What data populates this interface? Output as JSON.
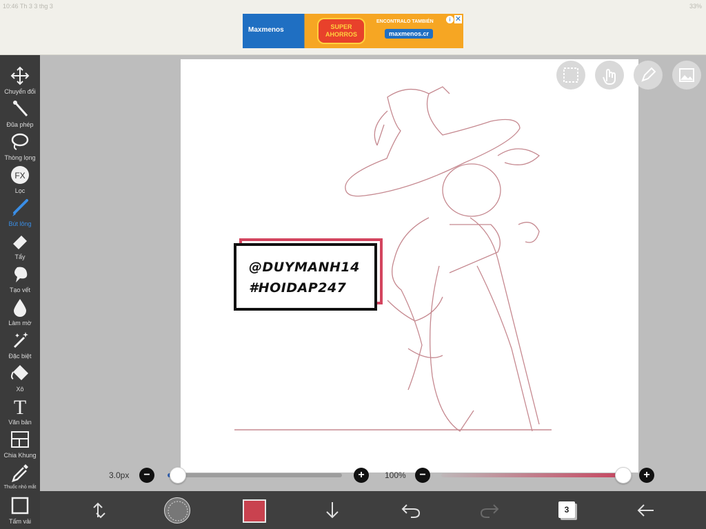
{
  "status_bar": {
    "left_text": "10:46  Th 3 3 thg 3",
    "right_text": "33%"
  },
  "ad": {
    "brand": "Maxmenos",
    "promo": "SUPER AHORROS",
    "tagline": "ENCONTRALO TAMBIÉN",
    "site": "maxmenos.cr",
    "info_icon": "info-icon",
    "close_icon": "close-icon"
  },
  "toolbar": {
    "items": [
      {
        "label": "Chuyển đổi",
        "icon": "move-arrows-icon"
      },
      {
        "label": "Đũa phép",
        "icon": "magic-wand-icon"
      },
      {
        "label": "Thòng lọng",
        "icon": "lasso-icon"
      },
      {
        "label": "Lọc",
        "icon": "fx-filter-icon"
      },
      {
        "label": "Bút lông",
        "icon": "brush-icon",
        "active": true
      },
      {
        "label": "Tẩy",
        "icon": "eraser-icon"
      },
      {
        "label": "Tạo vết",
        "icon": "smudge-icon"
      },
      {
        "label": "Làm mờ",
        "icon": "blur-drop-icon"
      },
      {
        "label": "Đặc biệt",
        "icon": "special-wand-icon"
      },
      {
        "label": "Xô",
        "icon": "bucket-icon"
      },
      {
        "label": "Văn bản",
        "icon": "text-icon"
      },
      {
        "label": "Chia Khung",
        "icon": "frame-divider-icon"
      },
      {
        "label": "Thuốc nhỏ mắt",
        "icon": "eyedropper-icon"
      },
      {
        "label": "Tấm vải",
        "icon": "canvas-icon"
      }
    ]
  },
  "floating_buttons": [
    "selection-icon",
    "hand-icon",
    "pencil-icon",
    "image-icon"
  ],
  "watermark": {
    "line1": "@DUYMANH14",
    "line2": "#HOIDAP247"
  },
  "brush_size": {
    "value_text": "3.0px",
    "level": 0.06
  },
  "opacity": {
    "value_text": "100%",
    "level": 1.0
  },
  "colors": {
    "brush_color": "#c9424f",
    "active_tool": "#3a8ee6",
    "toolbar_bg": "#3b3b3b"
  },
  "bottom_bar": {
    "layer_count": "3",
    "icons": [
      "transform-icon",
      "brush-preview-icon",
      "color-swatch-icon",
      "download-icon",
      "undo-icon",
      "redo-icon",
      "layers-icon",
      "back-icon"
    ]
  }
}
